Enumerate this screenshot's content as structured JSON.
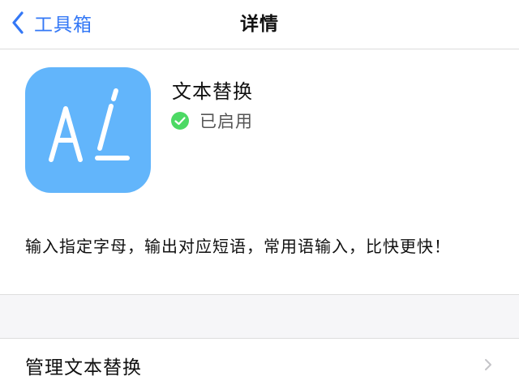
{
  "nav": {
    "back_label": "工具箱",
    "title": "详情"
  },
  "app": {
    "icon": "text-replace-app-icon",
    "name": "文本替换",
    "status_icon": "check-circle-icon",
    "status": "已启用",
    "description": "输入指定字母，输出对应短语，常用语输入，比快更快！"
  },
  "settings": {
    "manage_label": "管理文本替换",
    "chevron_icon": "chevron-right-icon"
  },
  "colors": {
    "accent": "#3478f6",
    "icon_bg": "#62b5fb",
    "status_green": "#4cd964",
    "section_bg": "#f6f6f8"
  }
}
